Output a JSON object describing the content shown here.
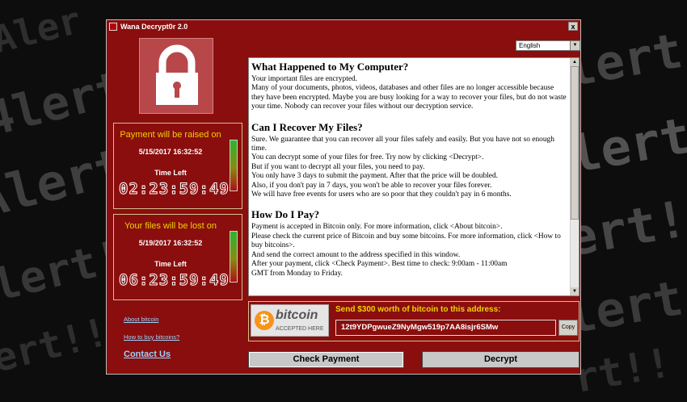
{
  "background": {
    "left_lines": [
      "Aler",
      "4lert!",
      "Alert",
      "lert!!",
      "ert!!"
    ],
    "right_lines": [
      "lert",
      "lert!",
      "ert!!!",
      "lert!!",
      "rt!!"
    ]
  },
  "window": {
    "title": "Wana Decrypt0r 2.0",
    "close": "x"
  },
  "language": {
    "selected": "English"
  },
  "timer1": {
    "heading": "Payment will be raised on",
    "date": "5/15/2017 16:32:52",
    "time_left_label": "Time Left",
    "clock": "02:23:59:49",
    "level": 0.85
  },
  "timer2": {
    "heading": "Your files will be lost on",
    "date": "5/19/2017 16:32:52",
    "time_left_label": "Time Left",
    "clock": "06:23:59:49",
    "level": 0.85
  },
  "links": {
    "about_bitcoin": "About bitcoin",
    "how_to_buy": "How to buy bitcoins?",
    "contact": "Contact Us"
  },
  "content": {
    "h1": "What Happened to My Computer?",
    "p1a": "Your important files are encrypted.",
    "p1b": "Many of your documents, photos, videos, databases and other files are no longer accessible because they have been encrypted. Maybe you are busy looking for a way to recover your files, but do not waste your time. Nobody can recover your files without our decryption service.",
    "h2": "Can I Recover My Files?",
    "p2a": "Sure. We guarantee that you can recover all your files safely and easily. But you have not so enough time.",
    "p2b": "You can decrypt some of your files for free. Try now by clicking <Decrypt>.",
    "p2c": "But if you want to decrypt all your files, you need to pay.",
    "p2d": "You only have 3 days to submit the payment. After that the price will be doubled.",
    "p2e": "Also, if you don't pay in 7 days, you won't be able to recover your files forever.",
    "p2f": "We will have free events for users who are so poor that they couldn't pay in 6 months.",
    "h3": "How Do I Pay?",
    "p3a": "Payment is accepted in Bitcoin only. For more information, click <About bitcoin>.",
    "p3b": "Please check the current price of Bitcoin and buy some bitcoins. For more information, click <How to buy bitcoins>.",
    "p3c": "And send the correct amount to the address specified in this window.",
    "p3d": "After your payment, click <Check Payment>. Best time to check: 9:00am - 11:00am",
    "p3e": "GMT from Monday to Friday."
  },
  "bitcoin": {
    "logo_symbol": "₿",
    "logo_name": "bitcoin",
    "logo_tag": "ACCEPTED HERE",
    "send_label": "Send $300 worth of bitcoin to this address:",
    "address": "12t9YDPgwueZ9NyMgw519p7AA8isjr6SMw",
    "copy": "Copy"
  },
  "buttons": {
    "check_payment": "Check Payment",
    "decrypt": "Decrypt"
  },
  "colors": {
    "window_red": "#8a0e0e",
    "accent_yellow": "#f0d200",
    "link_blue": "#9ad4ff"
  }
}
